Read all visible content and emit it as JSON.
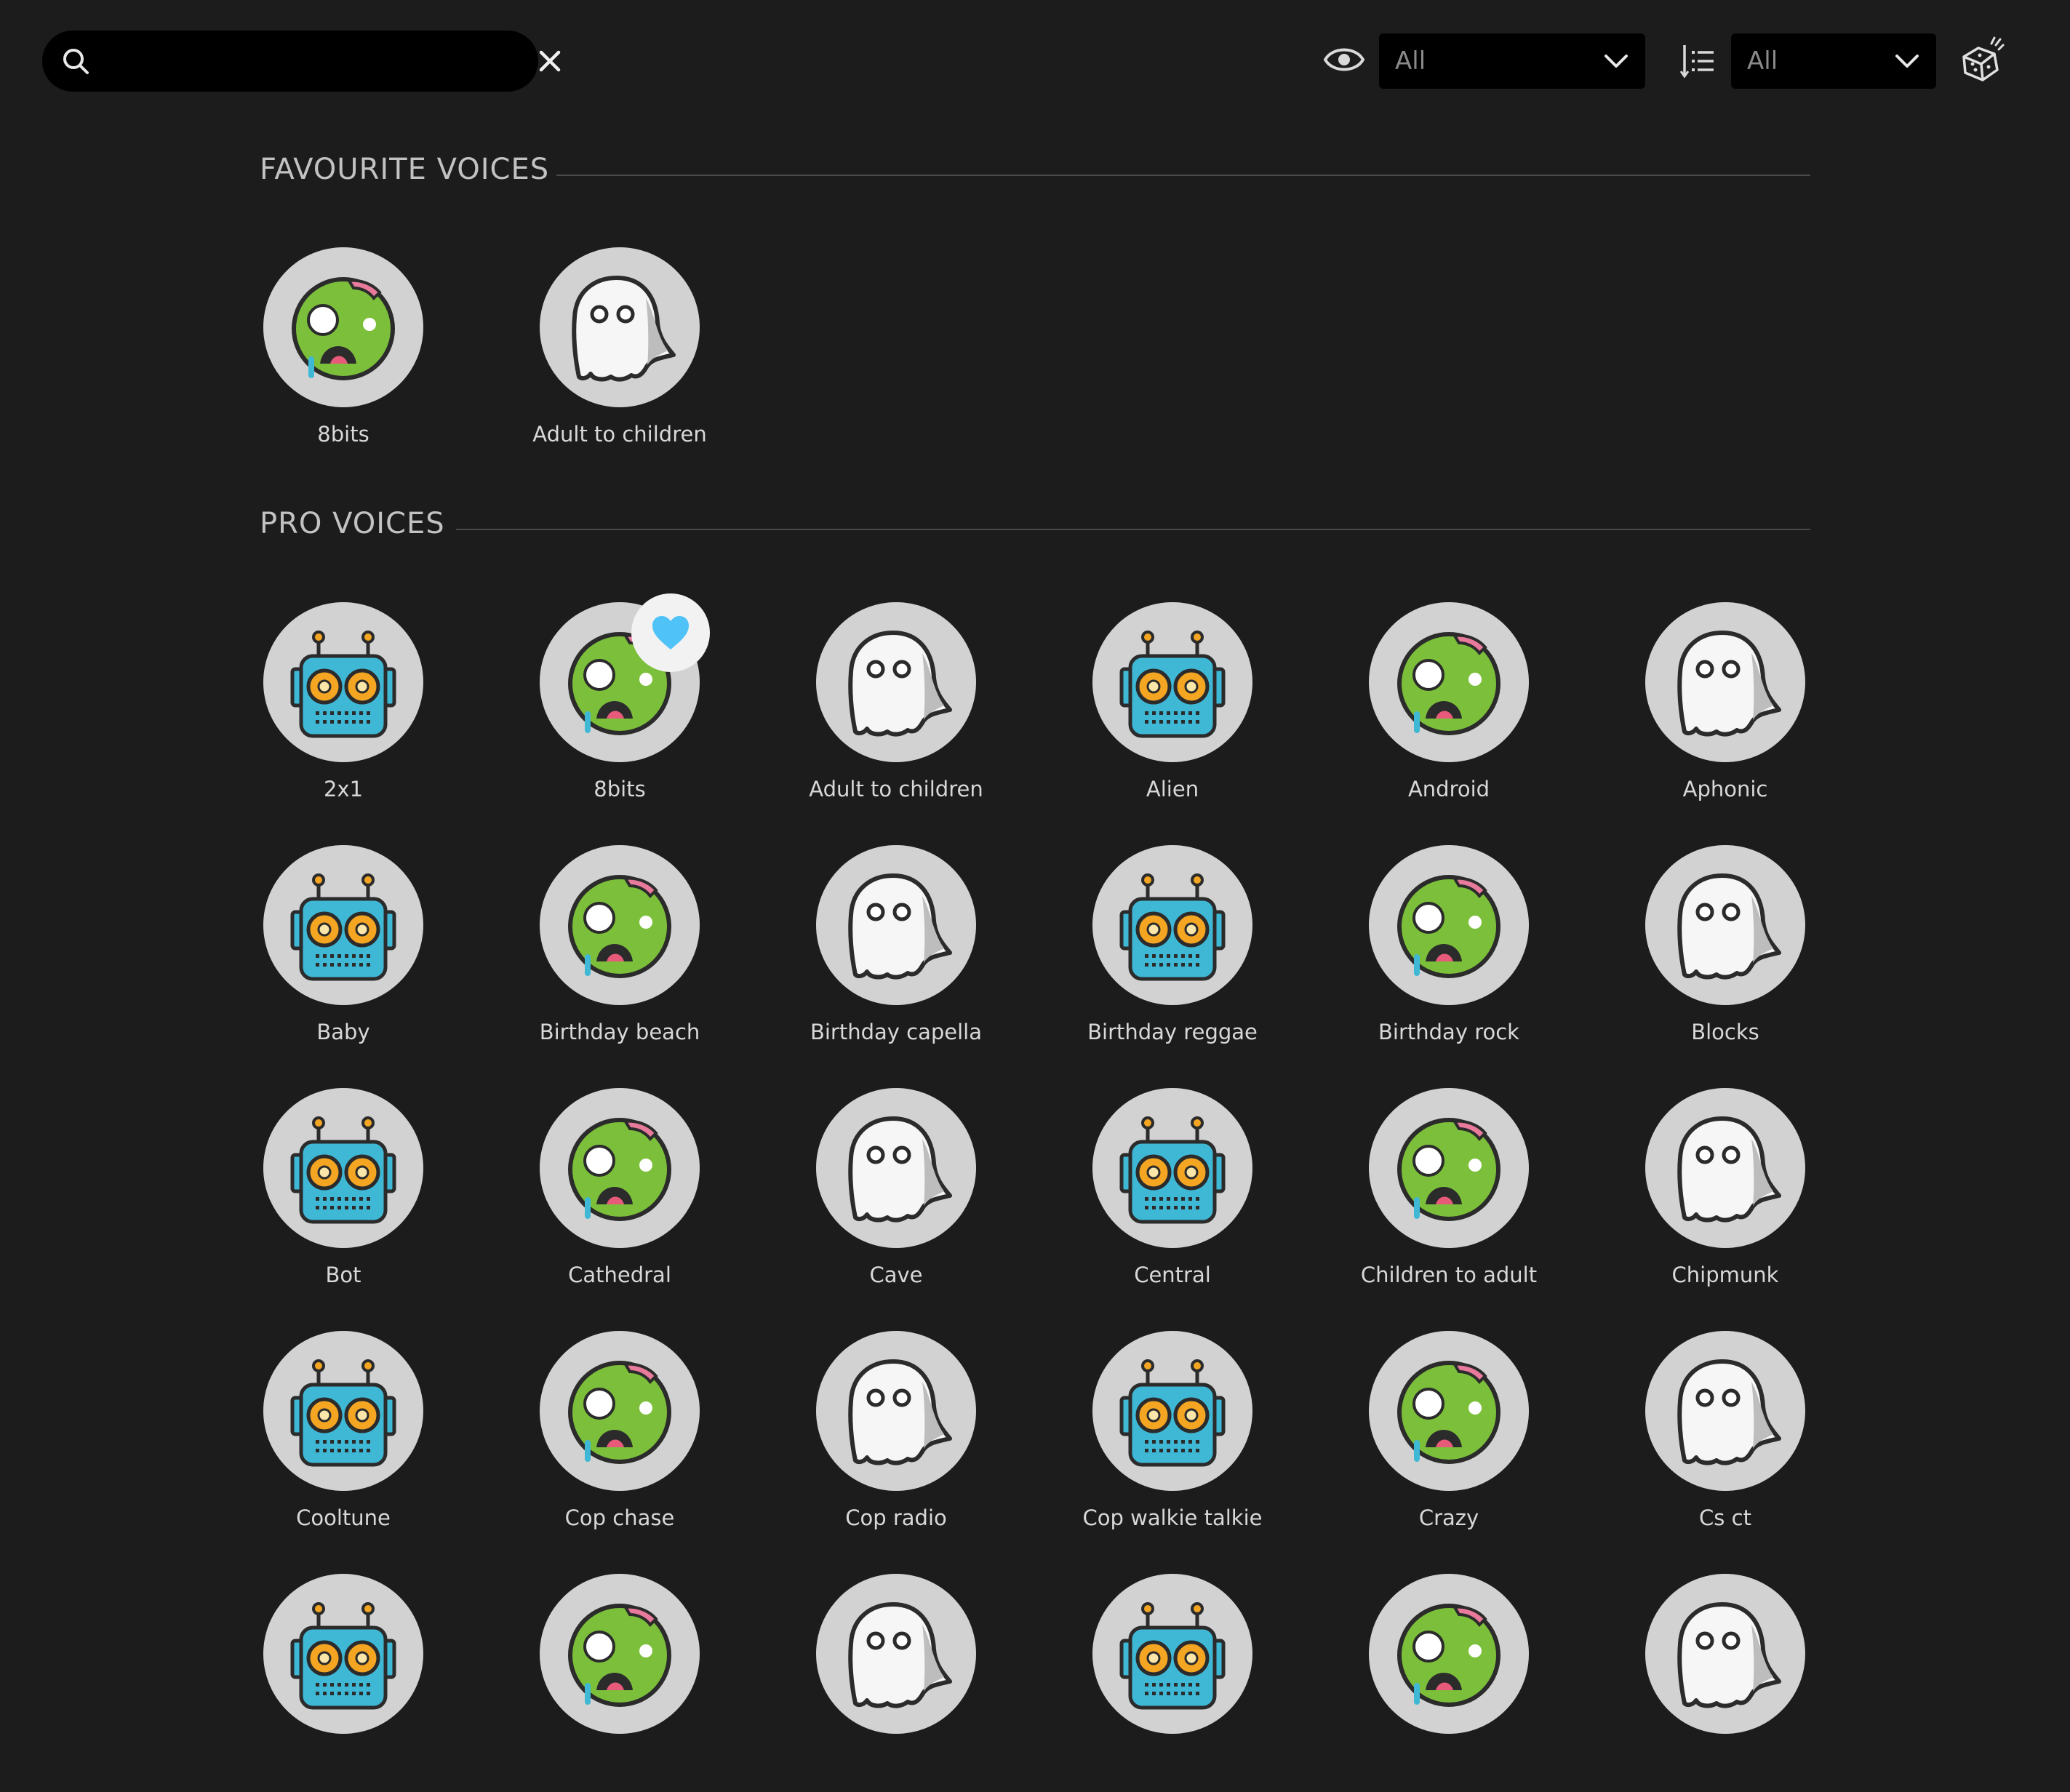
{
  "search": {
    "placeholder": "",
    "value": ""
  },
  "filters": {
    "visibility": {
      "icon": "eye-icon",
      "value": "All"
    },
    "sort": {
      "icon": "sort-list-icon",
      "value": "All"
    },
    "random": {
      "icon": "dice-icon"
    }
  },
  "sections": {
    "favourites": {
      "title": "FAVOURITE VOICES",
      "items": [
        {
          "label": "8bits",
          "icon": "zombie-icon"
        },
        {
          "label": "Adult to children",
          "icon": "ghost-icon"
        }
      ]
    },
    "pro": {
      "title": "PRO VOICES",
      "items": [
        {
          "label": "2x1",
          "icon": "robot-icon"
        },
        {
          "label": "8bits",
          "icon": "zombie-icon",
          "favourite": true
        },
        {
          "label": "Adult to children",
          "icon": "ghost-icon"
        },
        {
          "label": "Alien",
          "icon": "robot-icon"
        },
        {
          "label": "Android",
          "icon": "zombie-icon"
        },
        {
          "label": "Aphonic",
          "icon": "ghost-icon"
        },
        {
          "label": "Baby",
          "icon": "robot-icon"
        },
        {
          "label": "Birthday beach",
          "icon": "zombie-icon"
        },
        {
          "label": "Birthday capella",
          "icon": "ghost-icon"
        },
        {
          "label": "Birthday reggae",
          "icon": "robot-icon"
        },
        {
          "label": "Birthday rock",
          "icon": "zombie-icon"
        },
        {
          "label": "Blocks",
          "icon": "ghost-icon"
        },
        {
          "label": "Bot",
          "icon": "robot-icon"
        },
        {
          "label": "Cathedral",
          "icon": "zombie-icon"
        },
        {
          "label": "Cave",
          "icon": "ghost-icon"
        },
        {
          "label": "Central",
          "icon": "robot-icon"
        },
        {
          "label": "Children to adult",
          "icon": "zombie-icon"
        },
        {
          "label": "Chipmunk",
          "icon": "ghost-icon"
        },
        {
          "label": "Cooltune",
          "icon": "robot-icon"
        },
        {
          "label": "Cop chase",
          "icon": "zombie-icon"
        },
        {
          "label": "Cop radio",
          "icon": "ghost-icon"
        },
        {
          "label": "Cop walkie talkie",
          "icon": "robot-icon"
        },
        {
          "label": "Crazy",
          "icon": "zombie-icon"
        },
        {
          "label": "Cs ct",
          "icon": "ghost-icon"
        },
        {
          "label": "",
          "icon": "robot-icon"
        },
        {
          "label": "",
          "icon": "zombie-icon"
        },
        {
          "label": "",
          "icon": "ghost-icon"
        },
        {
          "label": "",
          "icon": "robot-icon"
        },
        {
          "label": "",
          "icon": "zombie-icon"
        },
        {
          "label": "",
          "icon": "ghost-icon"
        }
      ]
    }
  },
  "colors": {
    "background": "#1c1c1c",
    "avatar_bg": "#d2d2d2",
    "robot_body": "#3fb8d6",
    "robot_eyes": "#f4a623",
    "zombie_face": "#7cbf3a",
    "ghost_body": "#f6f6f6",
    "heart": "#4fc3f7"
  }
}
